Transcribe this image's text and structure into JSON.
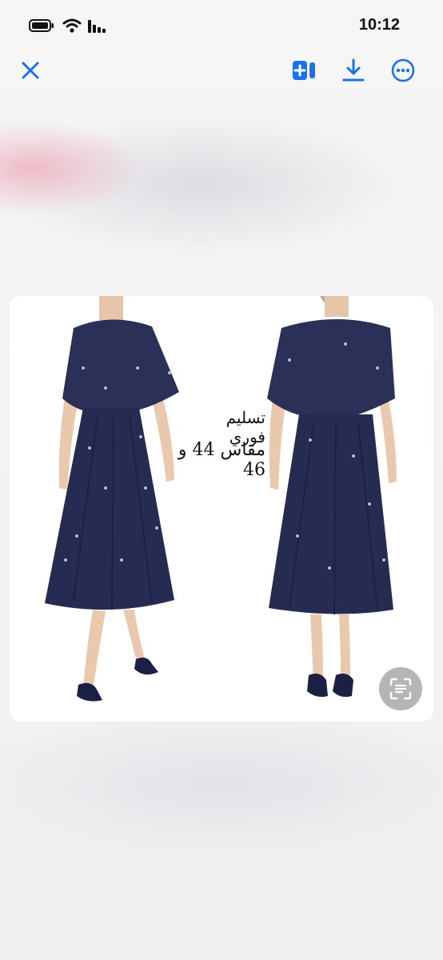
{
  "status_bar": {
    "time": "10:12"
  },
  "toolbar": {
    "close_icon": "close-icon",
    "add_icon": "add-to-card-icon",
    "download_icon": "download-icon",
    "more_icon": "more-icon"
  },
  "photo": {
    "caption_line1": "تسليم فوري",
    "caption_line2": "مقاس 44 و 46"
  },
  "colors": {
    "accent": "#1a73e8",
    "dress": "#2a2f56",
    "dress_shadow": "#1c2045",
    "skin": "#e9c8ae"
  }
}
